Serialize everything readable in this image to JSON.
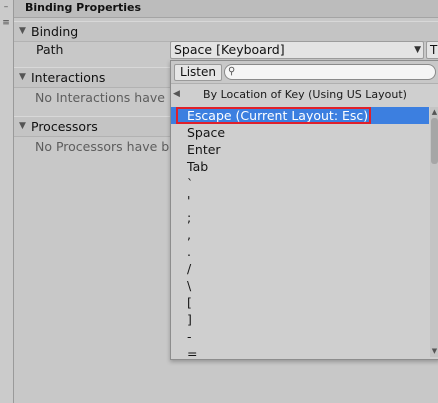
{
  "header": {
    "title": "Binding Properties"
  },
  "binding": {
    "section_label": "Binding",
    "path_label": "Path",
    "path_value": "Space [Keyboard]",
    "t_button_label": "T"
  },
  "interactions": {
    "section_label": "Interactions",
    "empty_text": "No Interactions have bee"
  },
  "processors": {
    "section_label": "Processors",
    "empty_text": "No Processors have bee"
  },
  "popup": {
    "listen_label": "Listen",
    "search_value": "",
    "group_header": "By Location of Key (Using US Layout)",
    "items": [
      {
        "label": "Escape (Current Layout: Esc)",
        "selected": true
      },
      {
        "label": "Space"
      },
      {
        "label": "Enter"
      },
      {
        "label": "Tab"
      },
      {
        "label": "`"
      },
      {
        "label": "'"
      },
      {
        "label": ";"
      },
      {
        "label": ","
      },
      {
        "label": "."
      },
      {
        "label": "/"
      },
      {
        "label": "\\"
      },
      {
        "label": "["
      },
      {
        "label": "]"
      },
      {
        "label": "-"
      },
      {
        "label": "="
      }
    ]
  },
  "icons": {
    "section_arrow": "triangle-down-icon",
    "dropdown_caret": "caret-down-icon",
    "search": "magnifier-icon",
    "back": "triangle-left-icon",
    "scroll_up": "triangle-up-icon",
    "scroll_down": "triangle-down-icon"
  },
  "colors": {
    "selection": "#3c7fe0",
    "highlight_box": "#e0202a"
  }
}
